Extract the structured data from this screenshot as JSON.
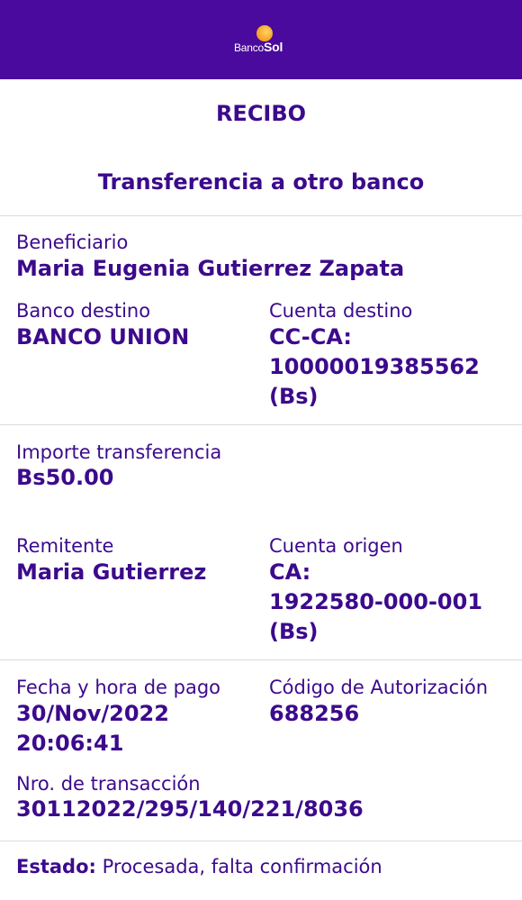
{
  "header": {
    "logo_text_regular": "Banco",
    "logo_text_bold": "Sol",
    "logo_icon": "sun-icon",
    "background_color": "#4b0a9e",
    "logo_accent_color": "#f7a92a"
  },
  "receipt": {
    "title": "RECIBO",
    "subtitle": "Transferencia a otro banco",
    "beneficiario_label": "Beneficiario",
    "beneficiario_value": "Maria Eugenia Gutierrez Zapata",
    "banco_destino_label": "Banco destino",
    "banco_destino_value": "BANCO UNION",
    "cuenta_destino_label": "Cuenta destino",
    "cuenta_destino_line1": "CC-CA:",
    "cuenta_destino_line2": "10000019385562",
    "cuenta_destino_line3": "(Bs)",
    "importe_label": "Importe transferencia",
    "importe_value": "Bs50.00",
    "remitente_label": "Remitente",
    "remitente_value": "Maria Gutierrez",
    "cuenta_origen_label": "Cuenta origen",
    "cuenta_origen_line1": "CA:",
    "cuenta_origen_line2": "1922580-000-001",
    "cuenta_origen_line3": "(Bs)",
    "fecha_label": "Fecha y hora de pago",
    "fecha_line1": "30/Nov/2022",
    "fecha_line2": "20:06:41",
    "codigo_label": "Código de Autorización",
    "codigo_value": "688256",
    "transaccion_label": "Nro. de transacción",
    "transaccion_value": "30112022/295/140/221/8036",
    "estado_label": "Estado:",
    "estado_value": "Procesada, falta confirmación"
  },
  "colors": {
    "text_primary": "#3c0a8c",
    "divider": "#dcdcdc"
  }
}
